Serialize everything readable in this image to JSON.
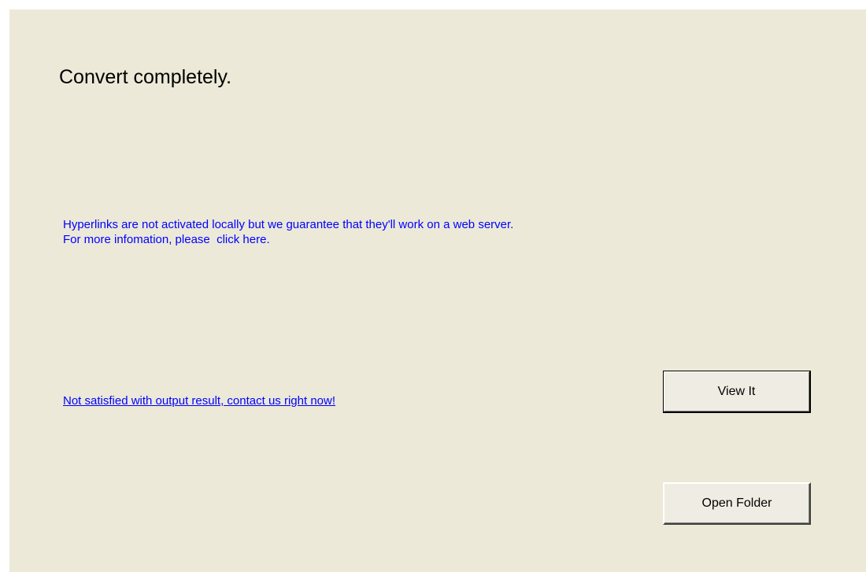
{
  "dialog": {
    "title": "Convert completely.",
    "info_line1": "Hyperlinks are not activated locally but we guarantee that they'll work on a web server.",
    "info_line2": "For more infomation, please  click here.",
    "contact_link": "Not satisfied with output result, contact us right now!",
    "view_button": "View It",
    "open_folder_button": "Open Folder"
  },
  "colors": {
    "background": "#ece9d8",
    "link": "#0000ff",
    "text": "#000000"
  }
}
